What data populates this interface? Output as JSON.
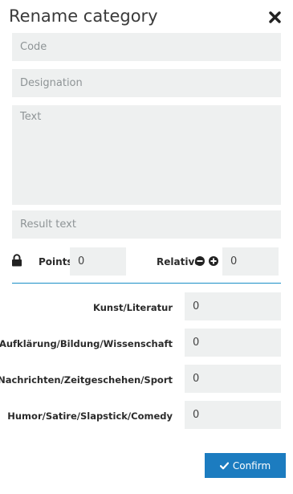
{
  "dialog": {
    "title": "Rename category"
  },
  "form": {
    "code_placeholder": "Code",
    "designation_placeholder": "Designation",
    "text_placeholder": "Text",
    "result_text_placeholder": "Result text"
  },
  "points": {
    "label": "Points",
    "value": "0"
  },
  "relative": {
    "label": "Relative",
    "value": "0"
  },
  "categories": [
    {
      "label": "Kunst/Literatur",
      "value": "0"
    },
    {
      "label": "Aufklärung/Bildung/Wissenschaft",
      "value": "0"
    },
    {
      "label": "Nachrichten/Zeitgeschehen/Sport",
      "value": "0"
    },
    {
      "label": "Humor/Satire/Slapstick/Comedy",
      "value": "0"
    }
  ],
  "actions": {
    "confirm_label": "Confirm"
  },
  "colors": {
    "accent": "#1c7cc0",
    "field_bg": "#eef0f0",
    "divider": "#1a8fc7"
  }
}
